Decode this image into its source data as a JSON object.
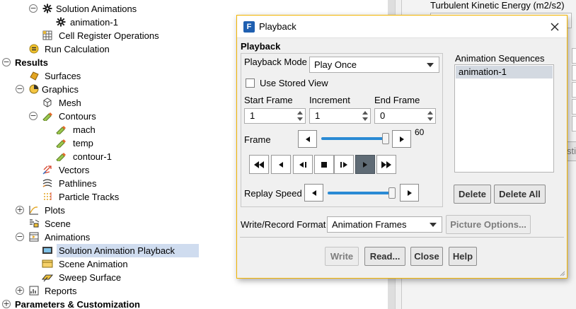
{
  "tree": {
    "items": [
      {
        "label": "Solution Animations",
        "icon": "gear-icon",
        "toggle": "−",
        "bold": false,
        "selected": false
      },
      {
        "label": "animation-1",
        "icon": "gear-icon",
        "toggle": "",
        "bold": false,
        "selected": false
      },
      {
        "label": "Cell Register Operations",
        "icon": "grid-icon",
        "toggle": "",
        "bold": false,
        "selected": false
      },
      {
        "label": "Run Calculation",
        "icon": "run-icon",
        "toggle": "",
        "bold": false,
        "selected": false
      },
      {
        "label": "Results",
        "icon": "",
        "toggle": "−",
        "bold": true,
        "selected": false
      },
      {
        "label": "Surfaces",
        "icon": "surfaces-icon",
        "toggle": "",
        "bold": false,
        "selected": false
      },
      {
        "label": "Graphics",
        "icon": "graphics-icon",
        "toggle": "−",
        "bold": false,
        "selected": false
      },
      {
        "label": "Mesh",
        "icon": "mesh-icon",
        "toggle": "",
        "bold": false,
        "selected": false
      },
      {
        "label": "Contours",
        "icon": "contour-icon",
        "toggle": "−",
        "bold": false,
        "selected": false
      },
      {
        "label": "mach",
        "icon": "contour-icon",
        "toggle": "",
        "bold": false,
        "selected": false
      },
      {
        "label": "temp",
        "icon": "contour-icon",
        "toggle": "",
        "bold": false,
        "selected": false
      },
      {
        "label": "contour-1",
        "icon": "contour-icon",
        "toggle": "",
        "bold": false,
        "selected": false
      },
      {
        "label": "Vectors",
        "icon": "vectors-icon",
        "toggle": "",
        "bold": false,
        "selected": false
      },
      {
        "label": "Pathlines",
        "icon": "pathlines-icon",
        "toggle": "",
        "bold": false,
        "selected": false
      },
      {
        "label": "Particle Tracks",
        "icon": "particle-tracks-icon",
        "toggle": "",
        "bold": false,
        "selected": false
      },
      {
        "label": "Plots",
        "icon": "plots-icon",
        "toggle": "+",
        "bold": false,
        "selected": false
      },
      {
        "label": "Scene",
        "icon": "scene-icon",
        "toggle": "",
        "bold": false,
        "selected": false
      },
      {
        "label": "Animations",
        "icon": "animations-icon",
        "toggle": "−",
        "bold": false,
        "selected": false
      },
      {
        "label": "Solution Animation Playback",
        "icon": "playback-icon",
        "toggle": "",
        "bold": false,
        "selected": true
      },
      {
        "label": "Scene Animation",
        "icon": "scene-animation-icon",
        "toggle": "",
        "bold": false,
        "selected": false
      },
      {
        "label": "Sweep Surface",
        "icon": "sweep-surface-icon",
        "toggle": "",
        "bold": false,
        "selected": false
      },
      {
        "label": "Reports",
        "icon": "reports-icon",
        "toggle": "+",
        "bold": false,
        "selected": false
      },
      {
        "label": "Parameters & Customization",
        "icon": "",
        "toggle": "+",
        "bold": true,
        "selected": false
      }
    ]
  },
  "background_panel": {
    "field_label": "Turbulent Kinetic Energy (m2/s2)",
    "button_fragment": "sti"
  },
  "dialog": {
    "title": "Playback",
    "app_icon_letter": "F",
    "section_title": "Playback",
    "playback_mode_label": "Playback Mode",
    "playback_mode_value": "Play Once",
    "use_stored_view_label": "Use Stored View",
    "use_stored_view_checked": false,
    "start_frame_label": "Start Frame",
    "increment_label": "Increment",
    "end_frame_label": "End Frame",
    "start_frame_value": "1",
    "increment_value": "1",
    "end_frame_value": "0",
    "frame_label": "Frame",
    "frame_value": "60",
    "frame_slider_fraction": 1.0,
    "replay_speed_label": "Replay Speed",
    "replay_speed_fraction": 1.0,
    "animation_sequences_label": "Animation Sequences",
    "animation_sequences": [
      "animation-1"
    ],
    "delete_label": "Delete",
    "delete_all_label": "Delete All",
    "write_format_label": "Write/Record Format",
    "write_format_value": "Animation Frames",
    "picture_options_label": "Picture Options...",
    "write_label": "Write",
    "read_label": "Read...",
    "close_label": "Close",
    "help_label": "Help"
  },
  "colors": {
    "dialog_border": "#f2b400",
    "selection": "#cfdcef",
    "slider_fill": "#2a8ad4",
    "active_play": "#5f6b75"
  }
}
